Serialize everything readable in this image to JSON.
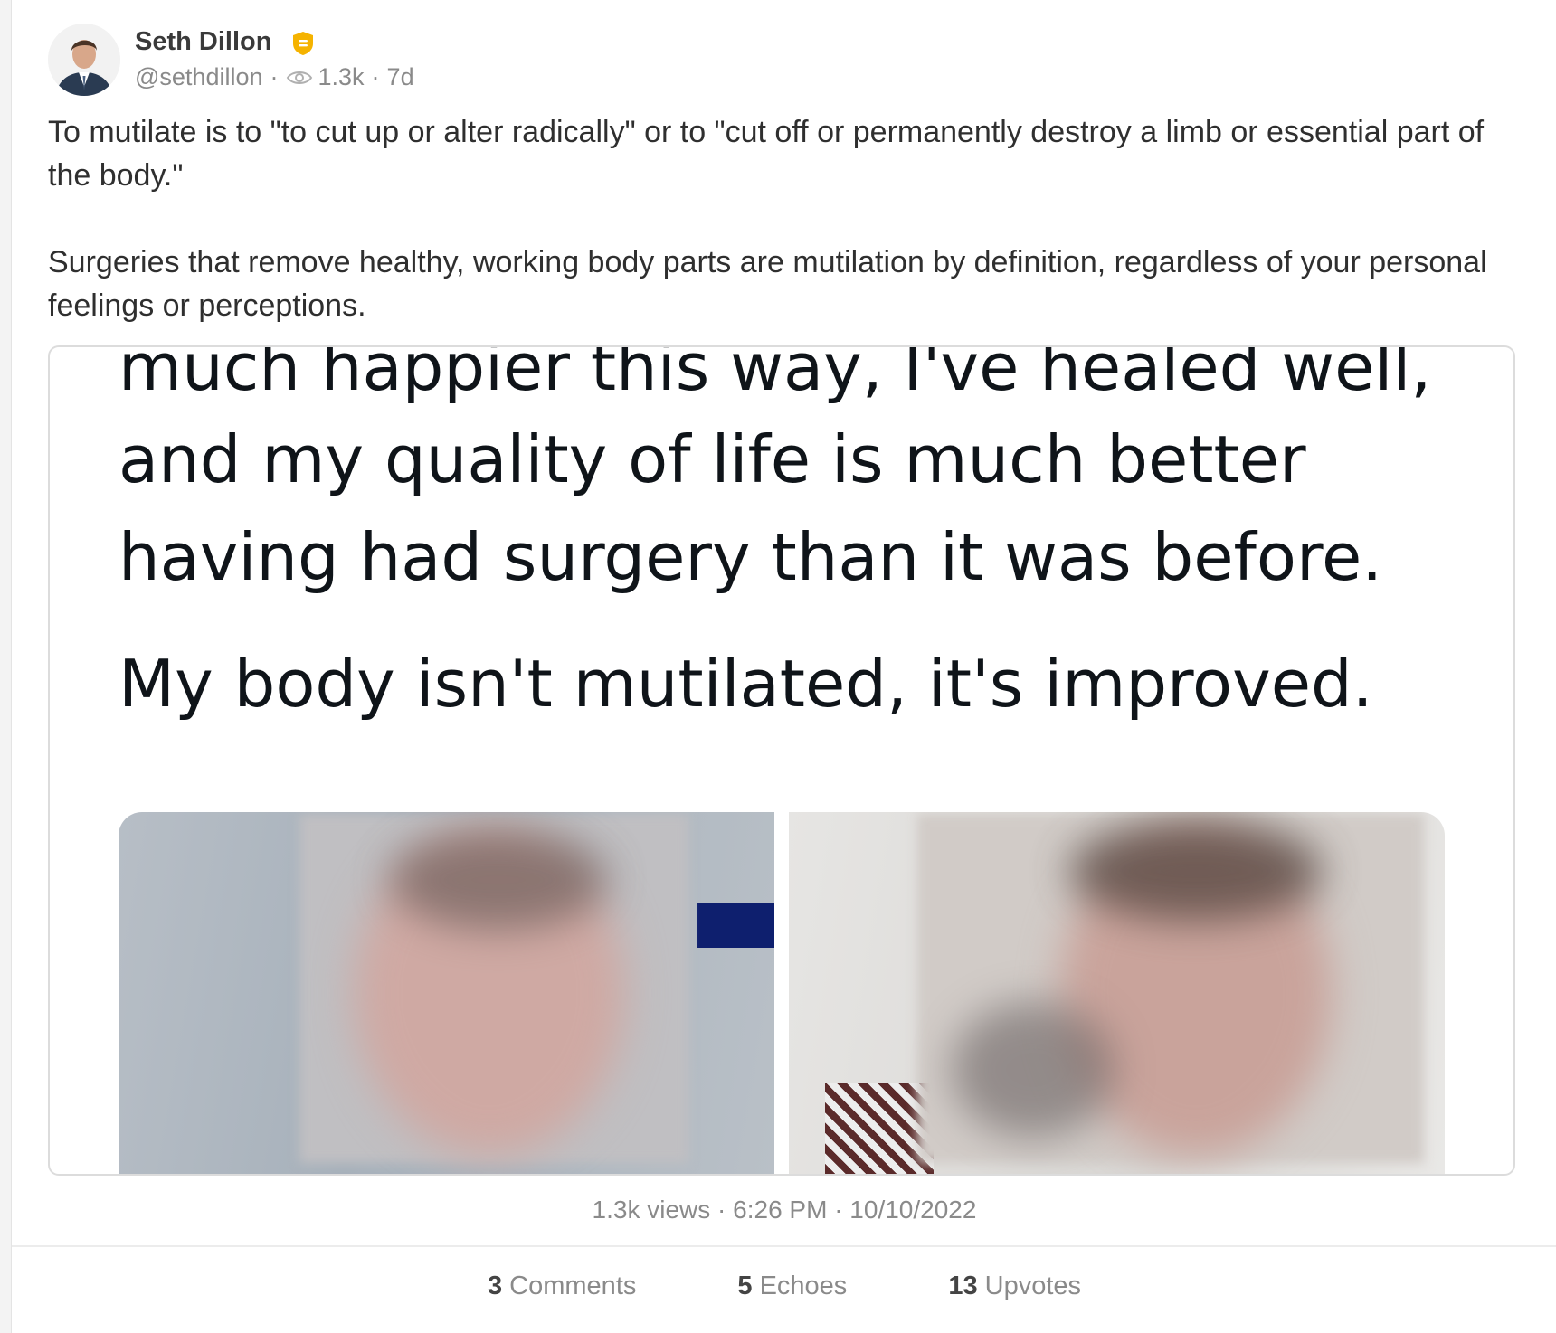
{
  "post": {
    "author": {
      "name": "Seth Dillon",
      "handle": "@sethdillon",
      "verified_badge_color": "#f5b300"
    },
    "meta": {
      "views_short": "1.3k",
      "age": "7d",
      "separator": "·"
    },
    "text": {
      "paragraph1": "To mutilate is to \"to cut up or alter radically\" or to \"cut off or permanently destroy a limb or essential part of the body.\"",
      "paragraph2": "Surgeries that remove healthy, working body parts are mutilation by definition, regardless of your personal feelings or perceptions."
    },
    "embedded_image": {
      "quote_lines": [
        "much happier this way, I've healed well,",
        "and my quality of life is much better",
        "having had surgery than it was before.",
        "My body isn't mutilated, it's improved."
      ],
      "photos": [
        "blurred-photo-left",
        "blurred-photo-right"
      ]
    },
    "footer": {
      "stats": "1.3k views · 6:26 PM · 10/10/2022"
    },
    "actions": {
      "comments_count": "3",
      "comments_label": "Comments",
      "echoes_count": "5",
      "echoes_label": "Echoes",
      "upvotes_count": "13",
      "upvotes_label": "Upvotes"
    }
  }
}
